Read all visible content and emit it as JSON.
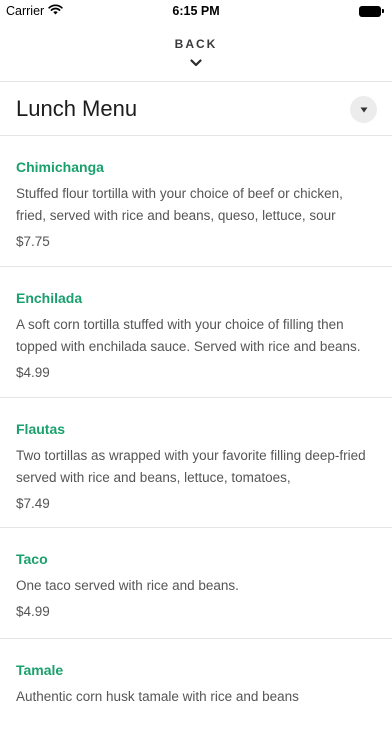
{
  "status_bar": {
    "carrier": "Carrier",
    "time": "6:15 PM"
  },
  "nav": {
    "back_label": "BACK"
  },
  "header": {
    "title": "Lunch Menu"
  },
  "menu": {
    "items": [
      {
        "name": "Chimichanga",
        "description": "Stuffed flour tortilla with your choice of beef or chicken, fried, served with rice and beans, queso, lettuce, sour",
        "price": "$7.75"
      },
      {
        "name": "Enchilada",
        "description": "A soft corn tortilla stuffed with your choice of filling then topped with enchilada sauce. Served with rice and beans.",
        "price": "$4.99"
      },
      {
        "name": "Flautas",
        "description": "Two tortillas as wrapped with your favorite filling deep-fried served with rice and beans, lettuce, tomatoes,",
        "price": "$7.49"
      },
      {
        "name": "Taco",
        "description": "One taco served with rice and beans.",
        "price": "$4.99"
      },
      {
        "name": "Tamale",
        "description": "Authentic corn husk tamale with rice and beans",
        "price": ""
      }
    ]
  },
  "colors": {
    "accent": "#1aa06d",
    "text_secondary": "#555555",
    "divider": "#e5e5e5"
  }
}
